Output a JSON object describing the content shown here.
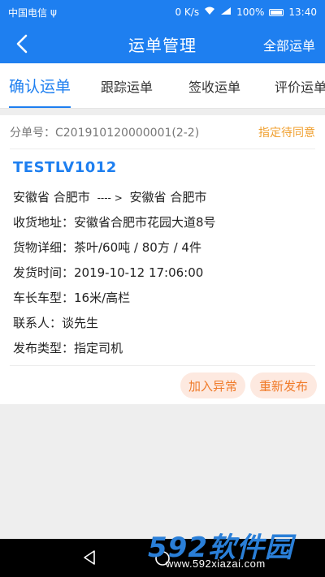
{
  "status_bar": {
    "carrier": "中国电信",
    "usb": "ψ",
    "speed": "0 K/s",
    "battery": "100%",
    "time": "13:40"
  },
  "header": {
    "title": "运单管理",
    "right_action": "全部运单",
    "back_icon": "chevron-left-icon"
  },
  "tabs": [
    {
      "label": "确认运单",
      "active": true
    },
    {
      "label": "跟踪运单",
      "active": false
    },
    {
      "label": "签收运单",
      "active": false
    },
    {
      "label": "评价运单",
      "active": false
    }
  ],
  "order": {
    "order_no": "分单号：C201910120000001(2-2)",
    "status": "指定待同意",
    "plate": "TESTLV1012",
    "route_from": "安徽省 合肥市",
    "route_arrow": "---- >",
    "route_to": "安徽省 合肥市",
    "address": "收货地址：安徽省合肥市花园大道8号",
    "goods": "货物详细：茶叶/60吨 / 80方 / 4件",
    "ship_time": "发货时间：2019-10-12 17:06:00",
    "vehicle": "车长车型：16米/高栏",
    "contact": "联系人：谈先生",
    "publish_type": "发布类型：指定司机",
    "actions": {
      "exception": "加入异常",
      "republish": "重新发布"
    }
  },
  "watermark": {
    "logo_num": "592",
    "logo_cn": "软件园",
    "url": "www.592xiazai.com"
  },
  "colors": {
    "primary": "#1e7ff0",
    "status_orange": "#f0a030",
    "button_bg": "#fde9e0",
    "button_text": "#f07b2a"
  }
}
